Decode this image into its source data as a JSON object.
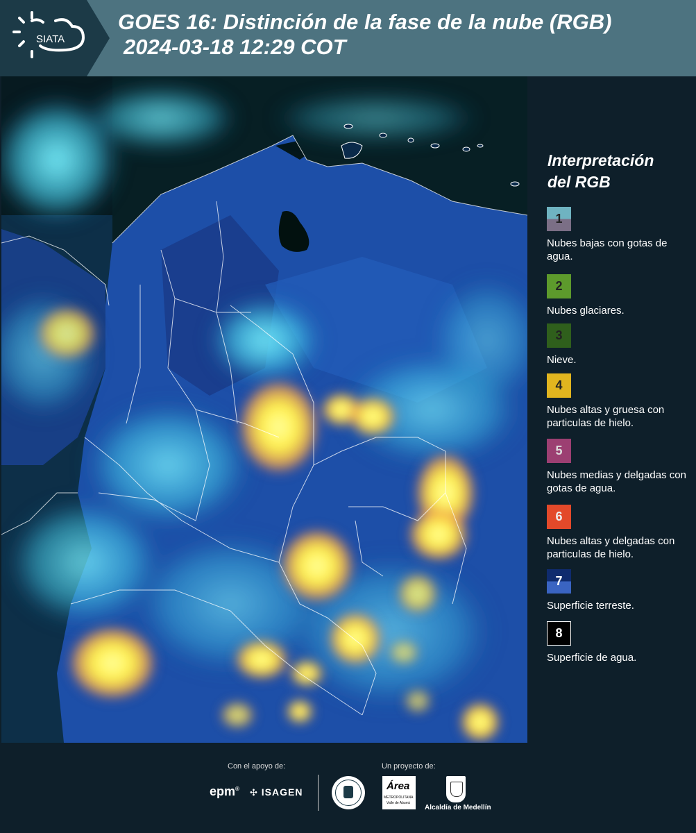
{
  "header": {
    "logo_text": "SIATA",
    "title_line1": "GOES 16: Distinción de la fase de la nube (RGB)",
    "title_line2": "2024-03-18 12:29 COT"
  },
  "legend": {
    "title_line1": "Interpretación",
    "title_line2": "del RGB",
    "items": [
      {
        "num": "1",
        "label": "Nubes bajas con gotas de agua.",
        "color_top": "#6fb3c1",
        "color_bottom": "#7b6f86"
      },
      {
        "num": "2",
        "label": "Nubes glaciares.",
        "color": "#5d9a2c"
      },
      {
        "num": "3",
        "label": "Nieve.",
        "color": "#2f5f1c"
      },
      {
        "num": "4",
        "label": "Nubes altas y gruesa con particulas de hielo.",
        "color": "#e1b51f"
      },
      {
        "num": "5",
        "label": "Nubes medias y delgadas con gotas de agua.",
        "color": "#9c3f72"
      },
      {
        "num": "6",
        "label": "Nubes altas y delgadas con particulas de hielo.",
        "color": "#e3492a"
      },
      {
        "num": "7",
        "label": "Superficie terreste.",
        "color_top": "#0f2b6e",
        "color_bottom": "#3a64c2"
      },
      {
        "num": "8",
        "label": "Superficie de agua.",
        "color": "#000000"
      }
    ]
  },
  "footer": {
    "support_label": "Con el apoyo de:",
    "project_label": "Un proyecto de:",
    "epm": "epm",
    "isagen": "ISAGEN",
    "area_name": "Área",
    "area_sub1": "METROPOLITANA",
    "area_sub2": "Valle de Aburrá",
    "alcaldia": "Alcaldía de Medellín"
  }
}
